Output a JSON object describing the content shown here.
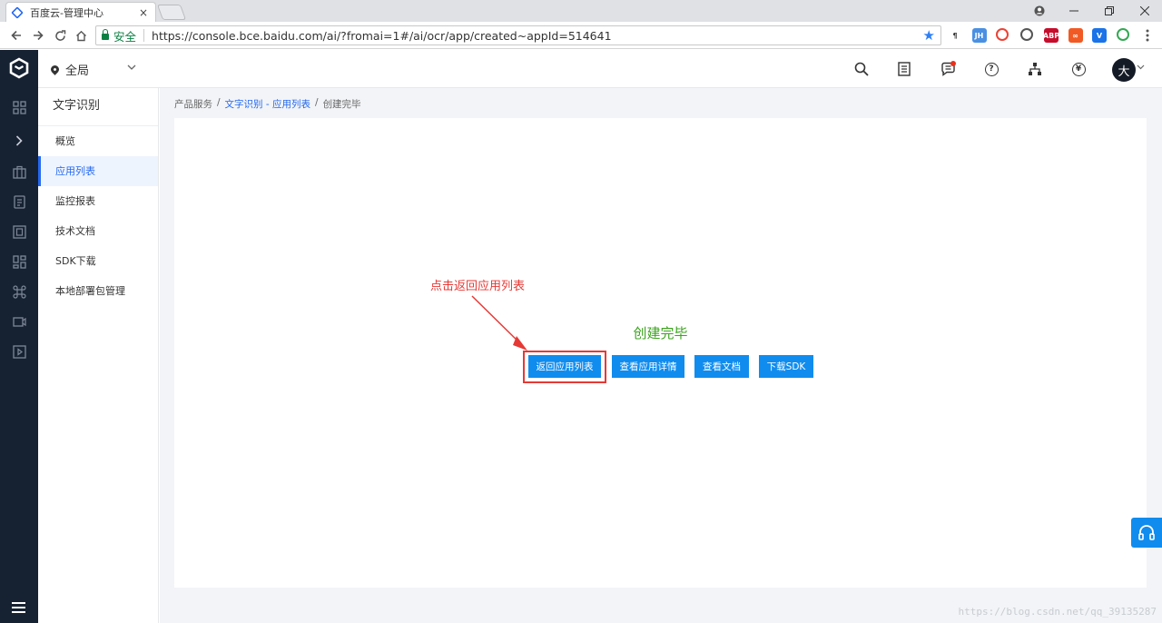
{
  "browser": {
    "tab_title": "百度云-管理中心",
    "tab_close": "×",
    "secure_label": "安全",
    "url": "https://console.bce.baidu.com/ai/?fromai=1#/ai/ocr/app/created~appId=514641",
    "extensions": [
      {
        "icon": "paragraph-icon",
        "text": "¶",
        "color": "#333333"
      },
      {
        "icon": "jh-icon",
        "text": "JH",
        "color": "#4a90e2"
      },
      {
        "icon": "colorful-icon",
        "text": "",
        "color": "#ea4335"
      },
      {
        "icon": "grid-icon",
        "text": "",
        "color": "#555555"
      },
      {
        "icon": "abp-icon",
        "text": "ABP",
        "color": "#c70d2c"
      },
      {
        "icon": "infinity-icon",
        "text": "∞",
        "color": "#f15a24"
      },
      {
        "icon": "v-icon",
        "text": "V",
        "color": "#1a73e8"
      },
      {
        "icon": "globe-icon",
        "text": "",
        "color": "#34a853"
      }
    ]
  },
  "header": {
    "region": "全局",
    "avatar_text": "大"
  },
  "subnav": {
    "title": "文字识别",
    "items": [
      {
        "label": "概览",
        "active": false
      },
      {
        "label": "应用列表",
        "active": true
      },
      {
        "label": "监控报表",
        "active": false
      },
      {
        "label": "技术文档",
        "active": false
      },
      {
        "label": "SDK下载",
        "active": false
      },
      {
        "label": "本地部署包管理",
        "active": false
      }
    ]
  },
  "breadcrumb": {
    "root": "产品服务",
    "sep": "/",
    "link": "文字识别 - 应用列表",
    "current": "创建完毕"
  },
  "main": {
    "status_title": "创建完毕",
    "buttons": {
      "back": "返回应用列表",
      "detail": "查看应用详情",
      "docs": "查看文档",
      "sdk": "下载SDK"
    },
    "annotation": "点击返回应用列表"
  },
  "watermark": "https://blog.csdn.net/qq_39135287",
  "colors": {
    "primary": "#108cee",
    "success_text": "#3aa31c",
    "annotation": "#e53935",
    "rail_bg": "#162131"
  }
}
